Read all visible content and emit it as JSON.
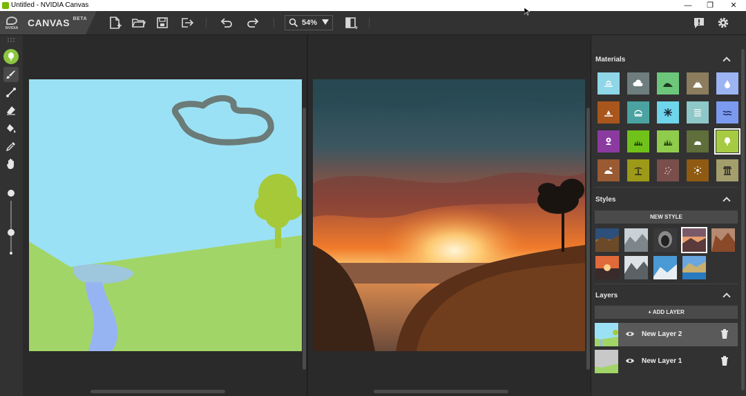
{
  "window": {
    "title": "Untitled - NVIDIA Canvas",
    "minimize": "—",
    "restore": "❐",
    "close": "✕"
  },
  "brand": {
    "name": "CANVAS",
    "badge": "BETA",
    "vendor": "NVIDIA"
  },
  "toolbar": {
    "zoom_value": "54%",
    "buttons": [
      "new-file-icon",
      "open-folder-icon",
      "save-icon",
      "export-icon",
      "undo-icon",
      "redo-icon",
      "swap-view-icon"
    ]
  },
  "right_toolbar": [
    "feedback-icon",
    "gear-icon"
  ],
  "left_tools": [
    "brush-icon",
    "line-icon",
    "eraser-icon",
    "fill-bucket-icon",
    "eyedropper-icon",
    "pan-hand-icon"
  ],
  "panels": {
    "materials": {
      "title": "Materials",
      "tiles": [
        {
          "icon": "sky-icon",
          "color": "#8ed6e8"
        },
        {
          "icon": "cloud-icon",
          "color": "#6e7d7d"
        },
        {
          "icon": "hill-icon",
          "color": "#6cc77a"
        },
        {
          "icon": "mountain-icon",
          "color": "#8b7d5e"
        },
        {
          "icon": "water-drop-icon",
          "color": "#9db4f2"
        },
        {
          "icon": "sand-icon",
          "color": "#a9561c"
        },
        {
          "icon": "fog-icon",
          "color": "#4aa3a0"
        },
        {
          "icon": "snowflake-icon",
          "color": "#6fd5ea"
        },
        {
          "icon": "wall-icon",
          "color": "#8ec8c8"
        },
        {
          "icon": "waves-icon",
          "color": "#7c9bf0"
        },
        {
          "icon": "flower-icon",
          "color": "#8b3aa0"
        },
        {
          "icon": "grass-icon",
          "color": "#70c21a"
        },
        {
          "icon": "bush-icon",
          "color": "#90cc4c"
        },
        {
          "icon": "rock-icon",
          "color": "#5f6e3a"
        },
        {
          "icon": "tree-icon",
          "color": "#a6cb42"
        },
        {
          "icon": "dirt-icon",
          "color": "#9a5a32"
        },
        {
          "icon": "palm-icon",
          "color": "#9c9a18"
        },
        {
          "icon": "gravel-icon",
          "color": "#7a4e4a"
        },
        {
          "icon": "stone-icon",
          "color": "#8f5a12"
        },
        {
          "icon": "building-icon",
          "color": "#a49e6c"
        }
      ],
      "selected_index": 14
    },
    "styles": {
      "title": "Styles",
      "new_style_label": "NEW STYLE",
      "selected_index": 3
    },
    "layers": {
      "title": "Layers",
      "add_label": "+ ADD LAYER",
      "items": [
        {
          "name": "New Layer 2",
          "active": true
        },
        {
          "name": "New Layer 1",
          "active": false
        }
      ]
    }
  },
  "colors": {
    "accent": "#76b900",
    "sketch_sky": "#9be1f5",
    "sketch_grass": "#a2d567",
    "sketch_water": "#97b4f2",
    "sketch_cloud": "#6b7b78",
    "sketch_tree": "#a6c93a"
  }
}
